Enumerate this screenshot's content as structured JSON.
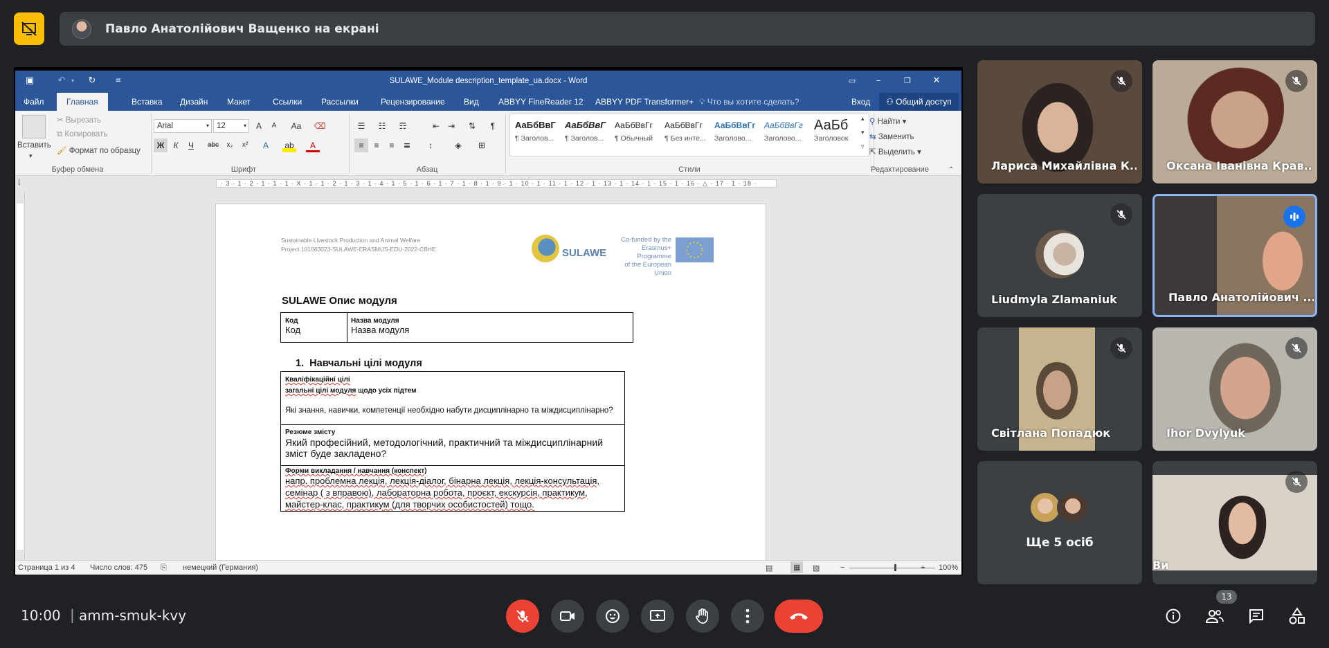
{
  "presenter": {
    "text": "Павло Анатолійович Ващенко на екрані"
  },
  "word": {
    "title": "SULAWE_Module description_template_ua.docx - Word",
    "tabs": [
      "Файл",
      "Главная",
      "Вставка",
      "Дизайн",
      "Макет",
      "Ссылки",
      "Рассылки",
      "Рецензирование",
      "Вид",
      "ABBYY FineReader 12",
      "ABBYY PDF Transformer+"
    ],
    "tell_me": "Что вы хотите сделать?",
    "login": "Вход",
    "share": "Общий доступ",
    "clipboard": {
      "paste": "Вставить",
      "cut": "Вырезать",
      "copy": "Копировать",
      "format_painter": "Формат по образцу",
      "label": "Буфер обмена"
    },
    "font": {
      "name": "Arial",
      "size": "12",
      "case": "Aa",
      "label": "Шрифт",
      "bold": "Ж",
      "italic": "К",
      "underline": "Ч",
      "strike": "abc",
      "sub": "x₂",
      "sup": "x²",
      "effects": "A",
      "color": "A",
      "grow": "A",
      "shrink": "A"
    },
    "paragraph": {
      "label": "Абзац"
    },
    "styles": {
      "label": "Стили",
      "items": [
        {
          "preview": "АаБбВвГ",
          "name": "¶ Заголов..."
        },
        {
          "preview": "АаБбВвГ",
          "name": "¶ Заголов..."
        },
        {
          "preview": "АаБбВвГг",
          "name": "¶ Обычный"
        },
        {
          "preview": "АаБбВвГг",
          "name": "¶ Без инте..."
        },
        {
          "preview": "АаБбВвГг",
          "name": "Заголово..."
        },
        {
          "preview": "АаБбВвГг",
          "name": "Заголово..."
        },
        {
          "preview": "АаБб",
          "name": "Заголовок"
        }
      ]
    },
    "editing": {
      "find": "Найти",
      "replace": "Заменить",
      "select": "Выделить",
      "label": "Редактирование"
    },
    "ruler": "· 3 · 1 · 2 · 1 · 1 · 1 · X · 1 · 1 · 2 · 1 · 3 · 1 · 4 · 1 · 5 · 1 · 6 · 1 · 7 · 1 · 8 · 1 · 9 · 1 · 10 · 1 · 11 · 1 · 12 · 1 · 13 · 1 · 14 · 1 · 15 · 1 · 16 · △ · 17 · 1 · 18 ·",
    "status": {
      "page": "Страница 1 из 4",
      "words": "Число слов: 475",
      "lang": "немецкий (Германия)",
      "zoom": "100%"
    }
  },
  "doc": {
    "header_line1": "Sustainable Livestock Production and Animal Welfare",
    "header_line2": "Project 101083023-SULAWE-ERASMUS-EDU-2022-CBHE",
    "logo_text": "SULAWE",
    "cofund_1": "Co-funded by the",
    "cofund_2": "Erasmus+ Programme",
    "cofund_3": "of the European Union",
    "title": "SULAWE Опис модуля",
    "code_label": "Код",
    "code_value": "Код",
    "module_label": "Назва модуля",
    "module_value": "Назва модуля",
    "section1_num": "1.",
    "section1_title": "Навчальні цілі модуля",
    "q_label": "Кваліфікаційні цілі",
    "q_sub_a": "загальні цілі модуля",
    "q_sub_b": " щодо усіх підтем",
    "q_text": "Які знання, навички, компетенції необхідно набути дисциплінарно та міждисциплінарно?",
    "r_label": "Резюме змісту",
    "r_text": "Який професійний, методологічний, практичний та міждисциплінарний зміст буде закладено?",
    "f_label": "Форми викладання / навчання (конспект)",
    "f_text": "напр. проблемна лекція, лекція-діалог, бінарна лекція, лекція-консультація, семінар ( з вправою), лабораторна робота, проєкт, екскурсія, практикум, майстер-клас, практикум (для творчих особистостей) тощо."
  },
  "participants": [
    {
      "name": "Лариса Михайлівна К..."
    },
    {
      "name": "Оксана Іванівна Крав..."
    },
    {
      "name": "Liudmyla Zlamaniuk"
    },
    {
      "name": "Павло Анатолійович ..."
    },
    {
      "name": "Світлана Попадюк"
    },
    {
      "name": "Ihor Dvylyuk"
    },
    {
      "name": "Ще 5 осіб"
    },
    {
      "name": "Ви"
    }
  ],
  "bottom": {
    "time": "10:00",
    "separator": "|",
    "code": "amm-smuk-kvy",
    "people_count": "13"
  },
  "colors": {
    "accent": "#1a73e8",
    "danger": "#ea4335",
    "warning": "#fbbc04",
    "word_blue": "#2b579a"
  }
}
